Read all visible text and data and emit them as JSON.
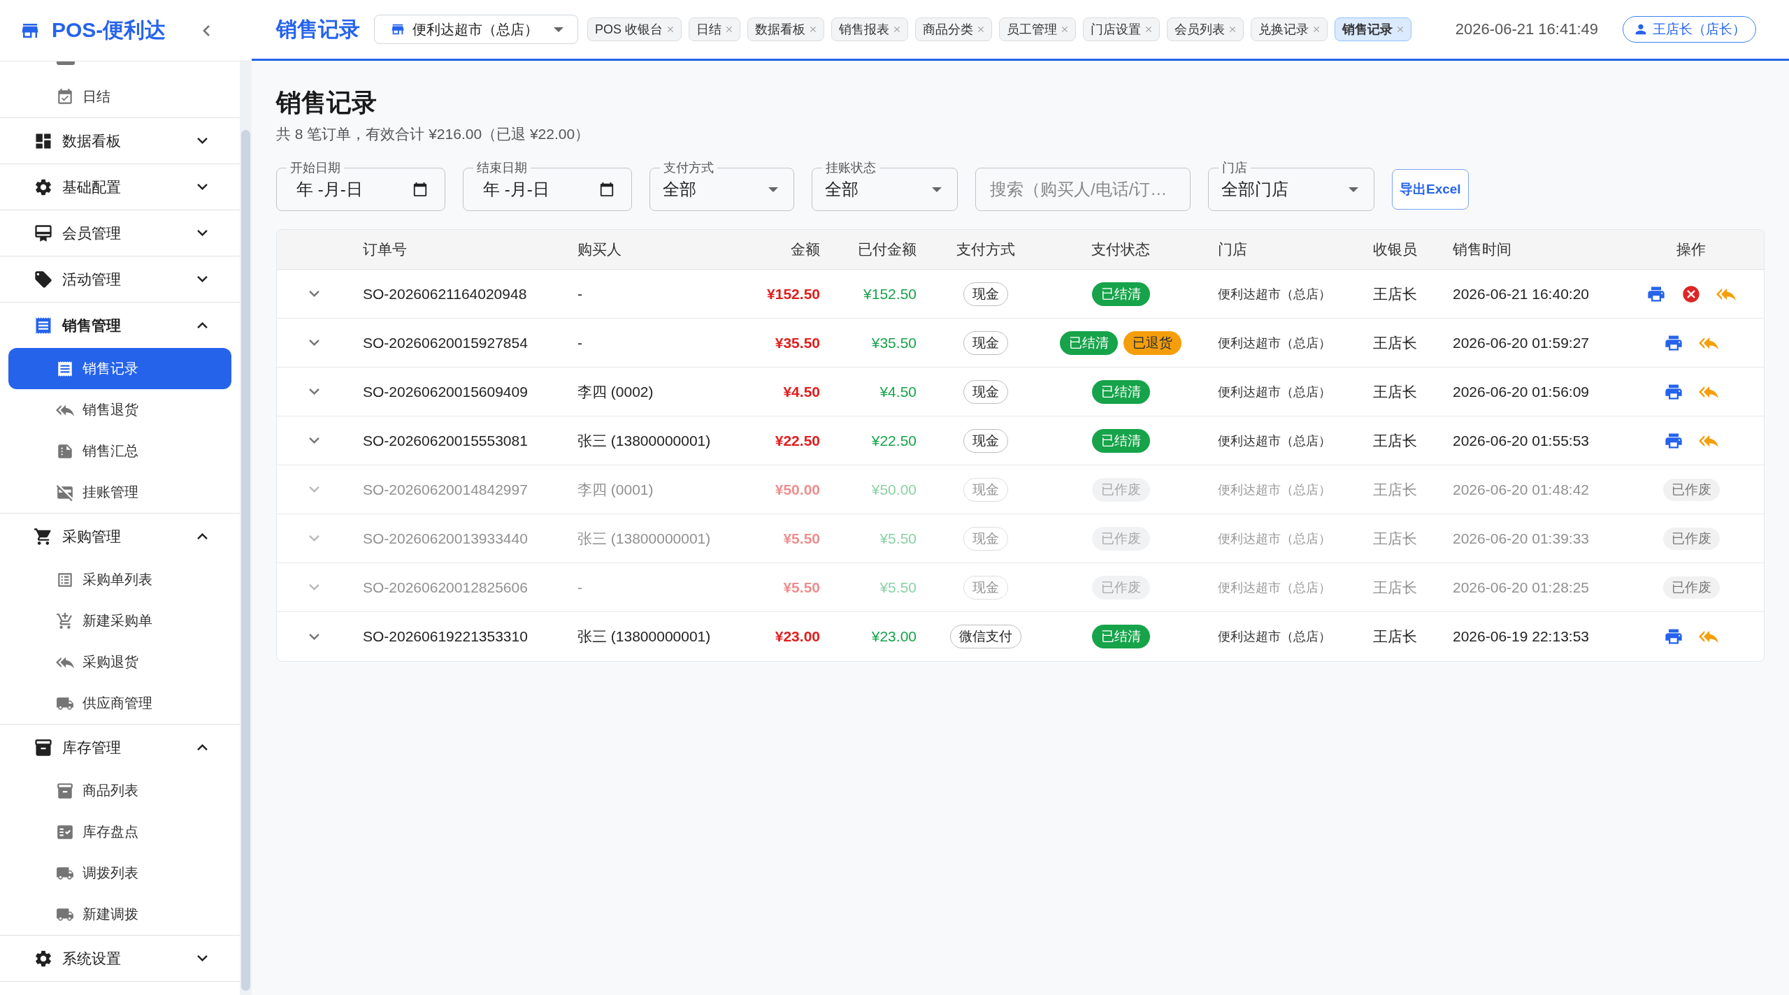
{
  "sidebar": {
    "logo": "POS-便利达",
    "nav": [
      {
        "children": [
          {
            "kind": "clipped"
          },
          {
            "kind": "link",
            "label": "日结",
            "selected": false
          }
        ]
      },
      {
        "label": "数据看板",
        "expanded": false,
        "active": false
      },
      {
        "label": "基础配置",
        "expanded": false,
        "active": false
      },
      {
        "label": "会员管理",
        "expanded": false,
        "active": false
      },
      {
        "label": "活动管理",
        "expanded": false,
        "active": false
      },
      {
        "label": "销售管理",
        "expanded": true,
        "active": true,
        "children": [
          {
            "kind": "link",
            "label": "销售记录",
            "selected": true
          },
          {
            "kind": "link",
            "label": "销售退货",
            "selected": false
          },
          {
            "kind": "link",
            "label": "销售汇总",
            "selected": false
          },
          {
            "kind": "link",
            "label": "挂账管理",
            "selected": false
          }
        ]
      },
      {
        "label": "采购管理",
        "expanded": true,
        "active": false,
        "children": [
          {
            "kind": "link",
            "label": "采购单列表",
            "selected": false
          },
          {
            "kind": "link",
            "label": "新建采购单",
            "selected": false
          },
          {
            "kind": "link",
            "label": "采购退货",
            "selected": false
          },
          {
            "kind": "link",
            "label": "供应商管理",
            "selected": false
          }
        ]
      },
      {
        "label": "库存管理",
        "expanded": true,
        "active": false,
        "children": [
          {
            "kind": "link",
            "label": "商品列表",
            "selected": false
          },
          {
            "kind": "link",
            "label": "库存盘点",
            "selected": false
          },
          {
            "kind": "link",
            "label": "调拨列表",
            "selected": false
          },
          {
            "kind": "link",
            "label": "新建调拨",
            "selected": false
          }
        ]
      },
      {
        "label": "系统设置",
        "expanded": false,
        "active": false
      }
    ]
  },
  "header": {
    "title": "销售记录",
    "store": "便利达超市（总店）",
    "tabs": [
      {
        "label": "POS 收银台",
        "selected": false
      },
      {
        "label": "日结",
        "selected": false
      },
      {
        "label": "数据看板",
        "selected": false
      },
      {
        "label": "销售报表",
        "selected": false
      },
      {
        "label": "商品分类",
        "selected": false
      },
      {
        "label": "员工管理",
        "selected": false
      },
      {
        "label": "门店设置",
        "selected": false
      },
      {
        "label": "会员列表",
        "selected": false
      },
      {
        "label": "兑换记录",
        "selected": false
      },
      {
        "label": "销售记录",
        "selected": true
      }
    ],
    "datetime": "2026-06-21 16:41:49",
    "user": "王店长（店长）"
  },
  "page": {
    "title": "销售记录",
    "summary": "共 8 笔订单，有效合计 ¥216.00（已退 ¥22.00）"
  },
  "filters": [
    {
      "kind": "date",
      "label": "开始日期",
      "value": "年 -月-日"
    },
    {
      "kind": "date",
      "label": "结束日期",
      "value": "年 -月-日"
    },
    {
      "kind": "select",
      "label": "支付方式",
      "value": "全部"
    },
    {
      "kind": "select",
      "label": "挂账状态",
      "value": "全部"
    },
    {
      "kind": "search",
      "placeholder": "搜索（购买人/电话/订…"
    },
    {
      "kind": "select",
      "label": "门店",
      "value": "全部门店"
    }
  ],
  "export_button": "导出Excel",
  "table": {
    "columns": [
      "订单号",
      "购买人",
      "金额",
      "已付金额",
      "支付方式",
      "支付状态",
      "门店",
      "收银员",
      "销售时间",
      "操作"
    ],
    "rows": [
      {
        "expanded": false,
        "voided": false,
        "order_no": "SO-20260621164020948",
        "buyer": "-",
        "amount": "¥152.50",
        "paid": "¥152.50",
        "pay_method": "现金",
        "statuses": [
          {
            "kind": "settled",
            "label": "已结清"
          }
        ],
        "store": "便利达超市（总店）",
        "cashier": "王店长",
        "time": "2026-06-21 16:40:20",
        "actions": [
          {
            "kind": "print"
          },
          {
            "kind": "cancel"
          },
          {
            "kind": "return"
          }
        ]
      },
      {
        "expanded": false,
        "voided": false,
        "order_no": "SO-20260620015927854",
        "buyer": "-",
        "amount": "¥35.50",
        "paid": "¥35.50",
        "pay_method": "现金",
        "statuses": [
          {
            "kind": "settled",
            "label": "已结清"
          },
          {
            "kind": "returned",
            "label": "已退货"
          }
        ],
        "store": "便利达超市（总店）",
        "cashier": "王店长",
        "time": "2026-06-20 01:59:27",
        "actions": [
          {
            "kind": "print"
          },
          {
            "kind": "return"
          }
        ]
      },
      {
        "expanded": false,
        "voided": false,
        "order_no": "SO-20260620015609409",
        "buyer": "李四 (0002)",
        "amount": "¥4.50",
        "paid": "¥4.50",
        "pay_method": "现金",
        "statuses": [
          {
            "kind": "settled",
            "label": "已结清"
          }
        ],
        "store": "便利达超市（总店）",
        "cashier": "王店长",
        "time": "2026-06-20 01:56:09",
        "actions": [
          {
            "kind": "print"
          },
          {
            "kind": "return"
          }
        ]
      },
      {
        "expanded": false,
        "voided": false,
        "order_no": "SO-20260620015553081",
        "buyer": "张三 (13800000001)",
        "amount": "¥22.50",
        "paid": "¥22.50",
        "pay_method": "现金",
        "statuses": [
          {
            "kind": "settled",
            "label": "已结清"
          }
        ],
        "store": "便利达超市（总店）",
        "cashier": "王店长",
        "time": "2026-06-20 01:55:53",
        "actions": [
          {
            "kind": "print"
          },
          {
            "kind": "return"
          }
        ]
      },
      {
        "expanded": false,
        "voided": true,
        "order_no": "SO-20260620014842997",
        "buyer": "李四 (0001)",
        "amount": "¥50.00",
        "paid": "¥50.00",
        "pay_method": "现金",
        "statuses": [
          {
            "kind": "void",
            "label": "已作废"
          }
        ],
        "store": "便利达超市（总店）",
        "cashier": "王店长",
        "time": "2026-06-20 01:48:42",
        "action_note": "已作废"
      },
      {
        "expanded": false,
        "voided": true,
        "order_no": "SO-20260620013933440",
        "buyer": "张三 (13800000001)",
        "amount": "¥5.50",
        "paid": "¥5.50",
        "pay_method": "现金",
        "statuses": [
          {
            "kind": "void",
            "label": "已作废"
          }
        ],
        "store": "便利达超市（总店）",
        "cashier": "王店长",
        "time": "2026-06-20 01:39:33",
        "action_note": "已作废"
      },
      {
        "expanded": false,
        "voided": true,
        "order_no": "SO-20260620012825606",
        "buyer": "-",
        "amount": "¥5.50",
        "paid": "¥5.50",
        "pay_method": "现金",
        "statuses": [
          {
            "kind": "void",
            "label": "已作废"
          }
        ],
        "store": "便利达超市（总店）",
        "cashier": "王店长",
        "time": "2026-06-20 01:28:25",
        "action_note": "已作废"
      },
      {
        "expanded": false,
        "voided": false,
        "order_no": "SO-20260619221353310",
        "buyer": "张三 (13800000001)",
        "amount": "¥23.00",
        "paid": "¥23.00",
        "pay_method": "微信支付",
        "statuses": [
          {
            "kind": "settled",
            "label": "已结清"
          }
        ],
        "store": "便利达超市（总店）",
        "cashier": "王店长",
        "time": "2026-06-19 22:13:53",
        "actions": [
          {
            "kind": "print"
          },
          {
            "kind": "return"
          }
        ]
      }
    ]
  }
}
